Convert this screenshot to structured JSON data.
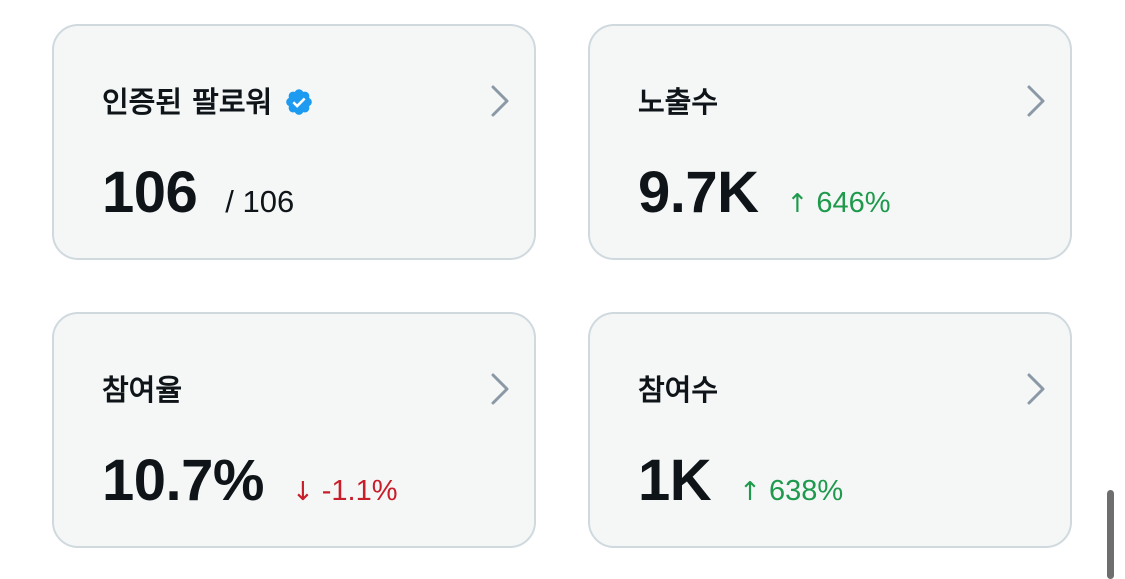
{
  "cards": [
    {
      "title": "인증된 팔로워",
      "value": "106",
      "sub_value": "/ 106",
      "verified": true
    },
    {
      "title": "노출수",
      "value": "9.7K",
      "change": "646%",
      "change_direction": "up",
      "change_arrow": "↑"
    },
    {
      "title": "참여율",
      "value": "10.7%",
      "change": "-1.1%",
      "change_direction": "down",
      "change_arrow": "↓"
    },
    {
      "title": "참여수",
      "value": "1K",
      "change": "638%",
      "change_direction": "up",
      "change_arrow": "↑"
    }
  ],
  "colors": {
    "card_background": "#f5f7f7",
    "card_border": "#cfd9de",
    "text_primary": "#0f1419",
    "change_up": "#1f9a4d",
    "change_down": "#c81e2a",
    "verified_badge": "#1d9bf0",
    "chevron": "#8b98a5"
  }
}
